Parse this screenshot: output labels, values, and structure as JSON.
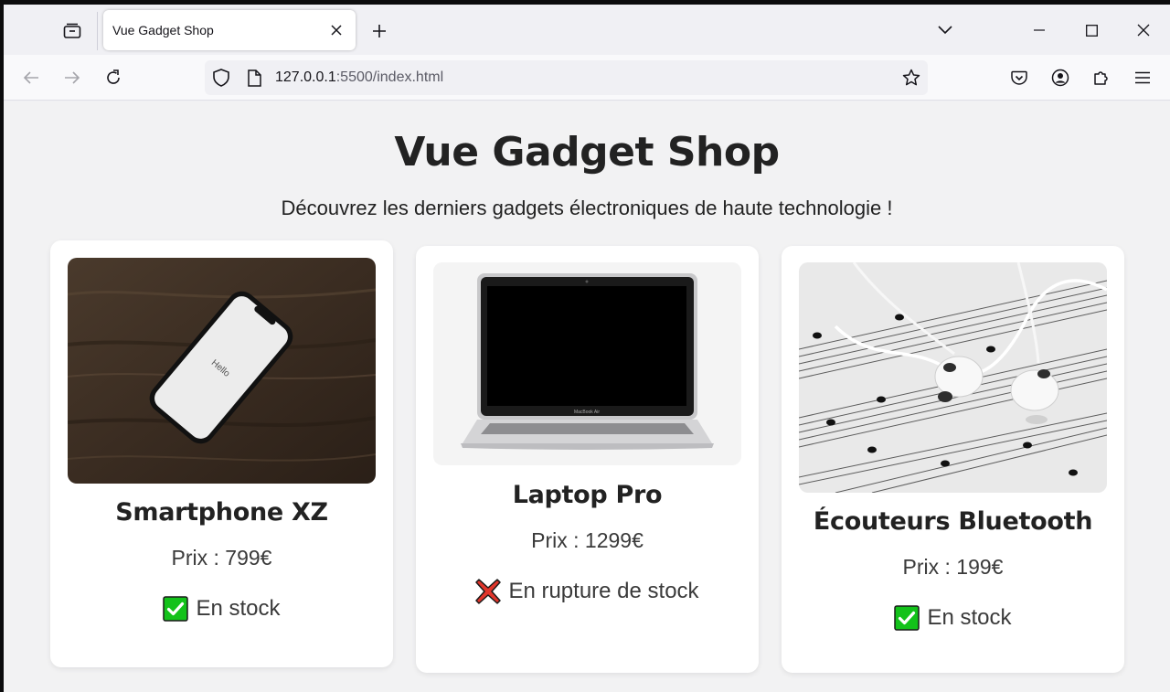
{
  "browser": {
    "tab_title": "Vue Gadget Shop",
    "url_host": "127.0.0.1",
    "url_rest": ":5500/index.html"
  },
  "page": {
    "title": "Vue Gadget Shop",
    "subtitle": "Découvrez les derniers gadgets électroniques de haute technologie !"
  },
  "products": [
    {
      "name": "Smartphone XZ",
      "price": "Prix : 799€",
      "stock_label": "En stock",
      "in_stock": true,
      "image": "smartphone-on-wood-table",
      "image_text": "Hello"
    },
    {
      "name": "Laptop Pro",
      "price": "Prix : 1299€",
      "stock_label": "En rupture de stock",
      "in_stock": false,
      "image": "silver-laptop",
      "image_text": "MacBook Air"
    },
    {
      "name": "Écouteurs Bluetooth",
      "price": "Prix : 199€",
      "stock_label": "En stock",
      "in_stock": true,
      "image": "earphones-on-sheet-music"
    }
  ],
  "colors": {
    "in_stock": "#13c21a",
    "out_of_stock": "#e0352b"
  }
}
